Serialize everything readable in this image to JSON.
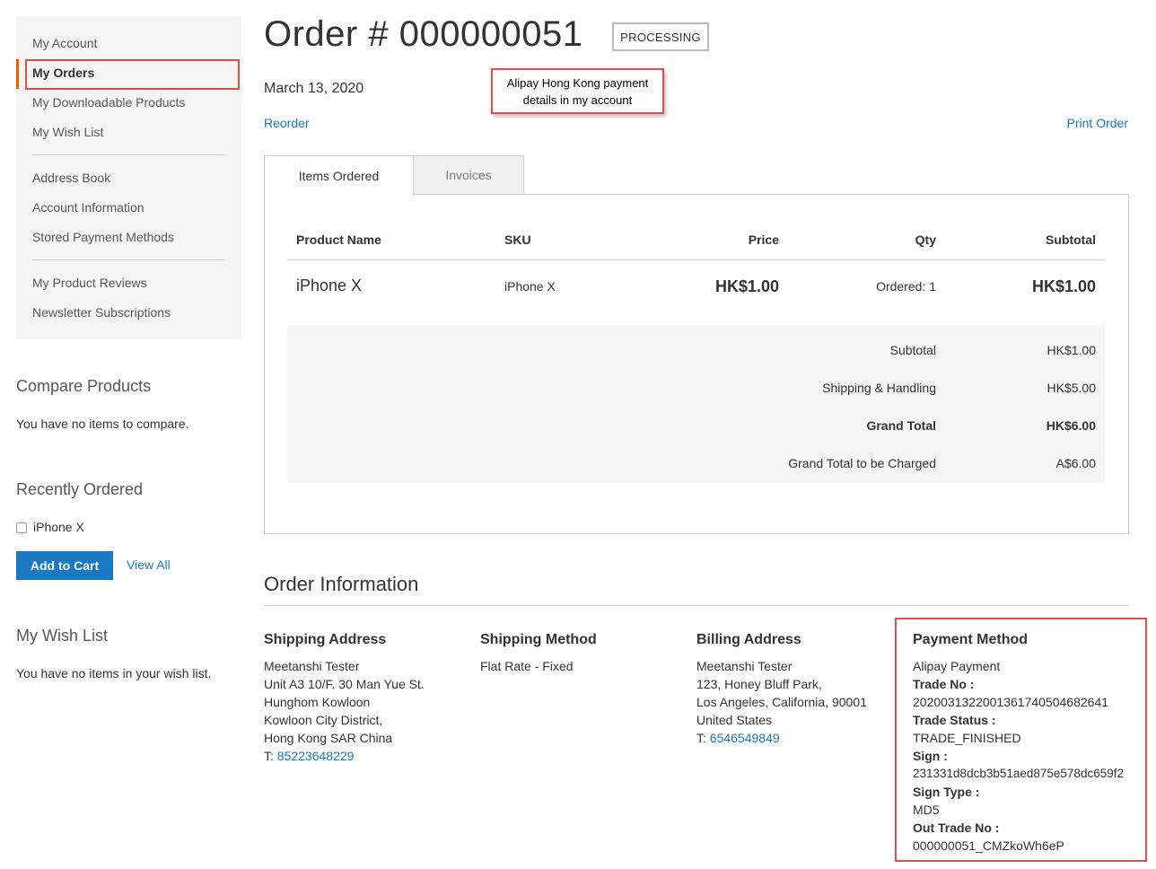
{
  "sidebar": {
    "items": [
      {
        "label": "My Account"
      },
      {
        "label": "My Orders"
      },
      {
        "label": "My Downloadable Products"
      },
      {
        "label": "My Wish List"
      },
      {
        "label": "Address Book"
      },
      {
        "label": "Account Information"
      },
      {
        "label": "Stored Payment Methods"
      },
      {
        "label": "My Product Reviews"
      },
      {
        "label": "Newsletter Subscriptions"
      }
    ],
    "current_accent_color": "#ff5501",
    "highlight_color": "#e04e4e"
  },
  "compare": {
    "title": "Compare Products",
    "empty_text": "You have no items to compare."
  },
  "recently_ordered": {
    "title": "Recently Ordered",
    "item_label": "iPhone X",
    "add_to_cart_label": "Add to Cart",
    "view_all_label": "View All"
  },
  "wishlist": {
    "title": "My Wish List",
    "empty_text": "You have no items in your wish list."
  },
  "order": {
    "title": "Order # 000000051",
    "status": "PROCESSING",
    "date": "March 13, 2020",
    "reorder_label": "Reorder",
    "print_label": "Print Order"
  },
  "callout": {
    "line1": "Alipay Hong  Kong payment",
    "line2": "details in my account"
  },
  "tabs": [
    {
      "label": "Items Ordered"
    },
    {
      "label": "Invoices"
    }
  ],
  "items_table": {
    "headers": {
      "name": "Product Name",
      "sku": "SKU",
      "price": "Price",
      "qty": "Qty",
      "subtotal": "Subtotal"
    },
    "rows": [
      {
        "name": "iPhone X",
        "sku": "iPhone X",
        "price": "HK$1.00",
        "qty": "Ordered: 1",
        "subtotal": "HK$1.00"
      }
    ]
  },
  "totals": [
    {
      "label": "Subtotal",
      "value": "HK$1.00"
    },
    {
      "label": "Shipping & Handling",
      "value": "HK$5.00"
    },
    {
      "label": "Grand Total",
      "value": "HK$6.00"
    },
    {
      "label": "Grand Total to be Charged",
      "value": "A$6.00"
    }
  ],
  "order_info": {
    "title": "Order Information",
    "shipping_address": {
      "title": "Shipping Address",
      "lines": [
        "Meetanshi Tester",
        "Unit A3 10/F. 30 Man Yue St.",
        "Hunghom Kowloon",
        "Kowloon City District,",
        "Hong Kong SAR China"
      ],
      "phone_prefix": "T: ",
      "phone": "85223648229"
    },
    "shipping_method": {
      "title": "Shipping Method",
      "value": "Flat Rate - Fixed"
    },
    "billing_address": {
      "title": "Billing Address",
      "lines": [
        "Meetanshi Tester",
        "123, Honey Bluff Park,",
        "Los Angeles, California, 90001",
        "United States"
      ],
      "phone_prefix": "T: ",
      "phone": "6546549849"
    },
    "payment_method": {
      "title": "Payment Method",
      "name": "Alipay Payment",
      "trade_no_label": "Trade No :",
      "trade_no": "20200313220013617405046826​41",
      "trade_status_label": "Trade Status :",
      "trade_status": "TRADE_FINISHED",
      "sign_label": "Sign :",
      "sign": "231331d8dcb3b51aed875e578dc659f2",
      "sign_type_label": "Sign Type :",
      "sign_type": "MD5",
      "out_trade_no_label": "Out Trade No :",
      "out_trade_no": "000000051_CMZkoWh6eP"
    }
  }
}
